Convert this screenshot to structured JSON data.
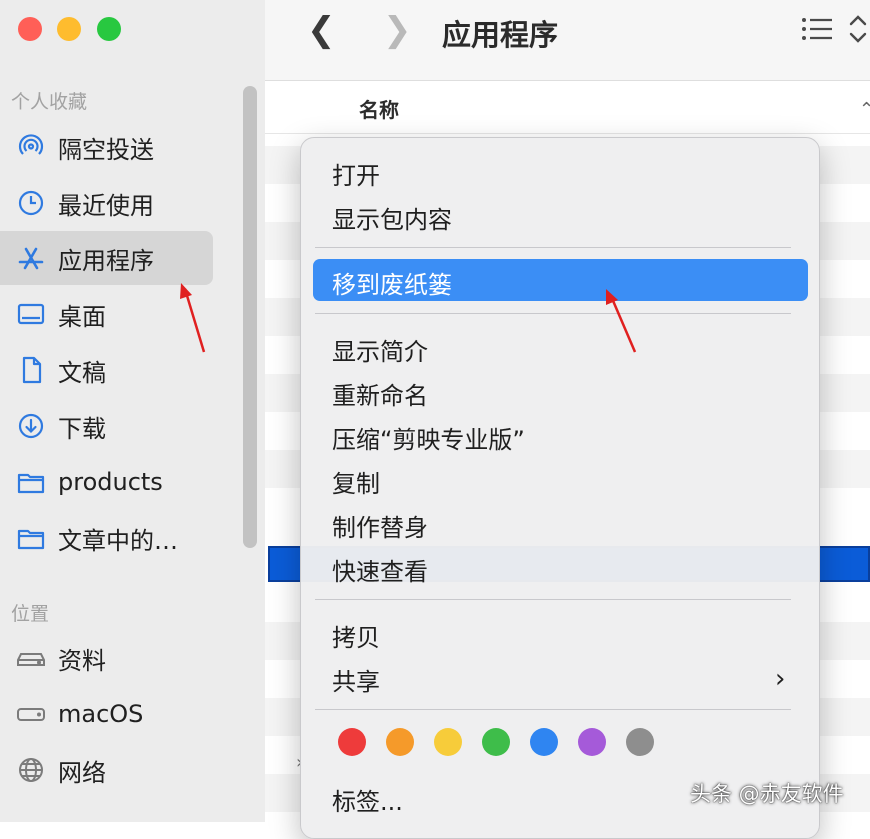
{
  "window": {
    "title": "应用程序"
  },
  "sidebar": {
    "favorites_title": "个人收藏",
    "locations_title": "位置",
    "favorites": [
      {
        "label": "隔空投送",
        "icon": "airdrop-icon"
      },
      {
        "label": "最近使用",
        "icon": "clock-icon"
      },
      {
        "label": "应用程序",
        "icon": "applications-icon",
        "selected": true
      },
      {
        "label": "桌面",
        "icon": "desktop-icon"
      },
      {
        "label": "文稿",
        "icon": "document-icon"
      },
      {
        "label": "下载",
        "icon": "download-icon"
      },
      {
        "label": "products",
        "icon": "folder-icon"
      },
      {
        "label": "文章中的…",
        "icon": "folder-icon"
      }
    ],
    "locations": [
      {
        "label": "资料",
        "icon": "external-drive-icon"
      },
      {
        "label": "macOS",
        "icon": "internal-drive-icon"
      },
      {
        "label": "网络",
        "icon": "network-globe-icon"
      }
    ]
  },
  "file_list": {
    "column_name": "名称"
  },
  "context_menu": {
    "items": {
      "open": "打开",
      "show_package": "显示包内容",
      "move_to_trash": "移到废纸篓",
      "get_info": "显示简介",
      "rename": "重新命名",
      "compress": "压缩“剪映专业版”",
      "duplicate": "复制",
      "make_alias": "制作替身",
      "quick_look": "快速查看",
      "copy": "拷贝",
      "share": "共享",
      "tags": "标签..."
    },
    "tag_colors": [
      "#ee3b3b",
      "#f59a2a",
      "#f7cc3a",
      "#3ebd4a",
      "#2f85f1",
      "#a55ad9",
      "#8e8e8e"
    ]
  },
  "colors": {
    "highlight": "#3b8ef5",
    "sidebar_icon": "#2f7ae0",
    "annotation_arrow": "#e02020"
  },
  "watermark": "头条 @赤友软件"
}
